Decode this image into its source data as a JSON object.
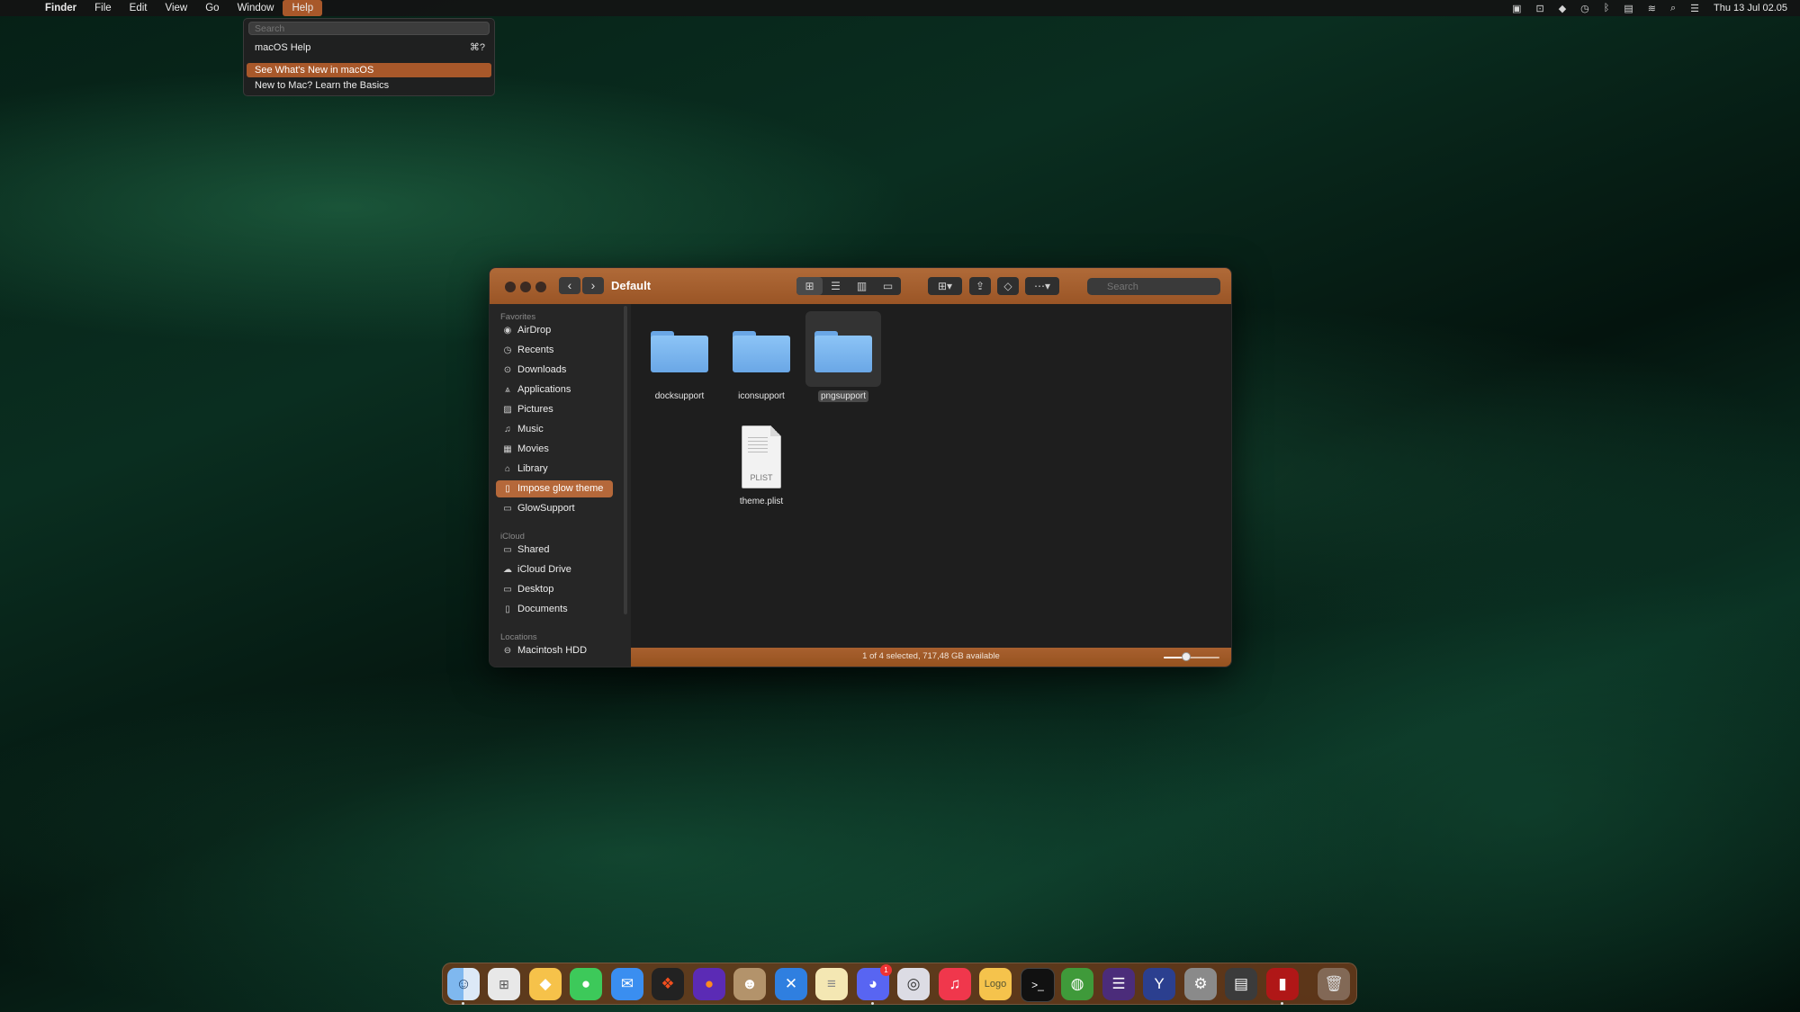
{
  "menubar": {
    "apple_icon": "apple-logo",
    "app_name": "Finder",
    "menus": [
      "File",
      "Edit",
      "View",
      "Go",
      "Window",
      "Help"
    ],
    "active_menu": "Help",
    "clock": "Thu 13 Jul  02.05",
    "status_icons": [
      "app-icon",
      "screen-icon",
      "flame-icon",
      "clock-icon",
      "bluetooth-icon",
      "keyboard-icon",
      "wifi-icon",
      "search-icon",
      "control-center-icon"
    ]
  },
  "help_menu": {
    "search_placeholder": "Search",
    "items": [
      {
        "label": "macOS Help",
        "shortcut": "⌘?"
      },
      {
        "label": "See What's New in macOS",
        "highlighted": true
      },
      {
        "label": "New to Mac? Learn the Basics"
      }
    ]
  },
  "finder": {
    "title": "Default",
    "search_placeholder": "Search",
    "sidebar": {
      "favorites_header": "Favorites",
      "favorites": [
        {
          "label": "AirDrop",
          "icon": "airdrop-icon"
        },
        {
          "label": "Recents",
          "icon": "clock-icon"
        },
        {
          "label": "Downloads",
          "icon": "download-icon"
        },
        {
          "label": "Applications",
          "icon": "applications-icon"
        },
        {
          "label": "Pictures",
          "icon": "photo-icon"
        },
        {
          "label": "Music",
          "icon": "music-icon"
        },
        {
          "label": "Movies",
          "icon": "film-icon"
        },
        {
          "label": "Library",
          "icon": "library-icon"
        },
        {
          "label": "Impose glow theme",
          "icon": "document-icon",
          "selected": true
        },
        {
          "label": "GlowSupport",
          "icon": "folder-icon"
        }
      ],
      "icloud_header": "iCloud",
      "icloud": [
        {
          "label": "Shared",
          "icon": "shared-folder-icon"
        },
        {
          "label": "iCloud Drive",
          "icon": "cloud-icon"
        },
        {
          "label": "Desktop",
          "icon": "desktop-icon"
        },
        {
          "label": "Documents",
          "icon": "document-icon"
        }
      ],
      "locations_header": "Locations",
      "locations": [
        {
          "label": "Macintosh HDD",
          "icon": "disk-icon"
        }
      ]
    },
    "files": [
      {
        "name": "docksupport",
        "kind": "folder"
      },
      {
        "name": "iconsupport",
        "kind": "folder"
      },
      {
        "name": "pngsupport",
        "kind": "folder",
        "selected": true
      },
      {
        "name": "theme.plist",
        "kind": "plist",
        "badge": "PLIST"
      }
    ],
    "status_text": "1 of 4 selected, 717,48 GB available",
    "icon_size_slider": 0.4
  },
  "dock": {
    "apps": [
      "finder-icon",
      "launchpad-icon",
      "sketch-icon",
      "messages-icon",
      "mail-icon",
      "figma-icon",
      "firefox-icon",
      "contacts-icon",
      "xcode-tools-icon",
      "notes-icon",
      "discord-icon",
      "music-player-icon",
      "itunes-icon",
      "logo-app-icon",
      "terminal-icon",
      "globe-icon",
      "notion-like-icon",
      "iterm-icon",
      "system-preferences-icon",
      "archive-icon",
      "red-app-icon",
      "trash-icon"
    ],
    "discord_badge": "1"
  }
}
